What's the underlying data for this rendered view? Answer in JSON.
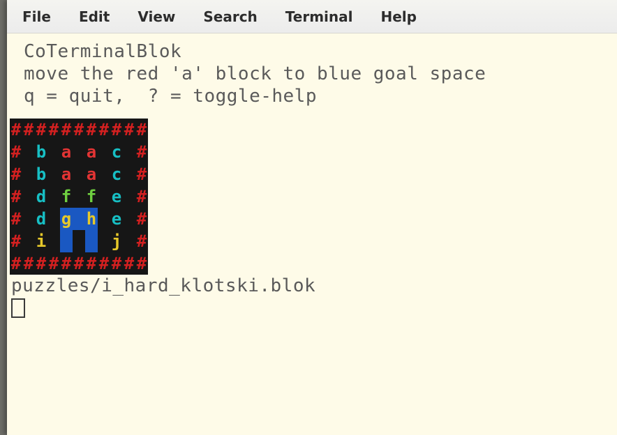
{
  "menubar": {
    "items": [
      "File",
      "Edit",
      "View",
      "Search",
      "Terminal",
      "Help"
    ]
  },
  "header": {
    "title": "CoTerminalBlok",
    "instruction": "move the red 'a' block to blue goal space",
    "controls": "q = quit,  ? = toggle-help"
  },
  "board": {
    "rows": [
      [
        {
          "ch": "#",
          "cls": "c-wall"
        },
        {
          "ch": "#",
          "cls": "c-wall"
        },
        {
          "ch": "#",
          "cls": "c-wall"
        },
        {
          "ch": "#",
          "cls": "c-wall"
        },
        {
          "ch": "#",
          "cls": "c-wall"
        },
        {
          "ch": "#",
          "cls": "c-wall"
        },
        {
          "ch": "#",
          "cls": "c-wall"
        },
        {
          "ch": "#",
          "cls": "c-wall"
        },
        {
          "ch": "#",
          "cls": "c-wall"
        },
        {
          "ch": "#",
          "cls": "c-wall"
        },
        {
          "ch": "#",
          "cls": "c-wall"
        }
      ],
      [
        {
          "ch": "#",
          "cls": "c-wall"
        },
        {
          "ch": " ",
          "cls": ""
        },
        {
          "ch": "b",
          "cls": "c-cyan"
        },
        {
          "ch": " ",
          "cls": ""
        },
        {
          "ch": "a",
          "cls": "c-red"
        },
        {
          "ch": " ",
          "cls": ""
        },
        {
          "ch": "a",
          "cls": "c-red"
        },
        {
          "ch": " ",
          "cls": ""
        },
        {
          "ch": "c",
          "cls": "c-cyan"
        },
        {
          "ch": " ",
          "cls": ""
        },
        {
          "ch": "#",
          "cls": "c-wall"
        }
      ],
      [
        {
          "ch": "#",
          "cls": "c-wall"
        },
        {
          "ch": " ",
          "cls": ""
        },
        {
          "ch": "b",
          "cls": "c-cyan"
        },
        {
          "ch": " ",
          "cls": ""
        },
        {
          "ch": "a",
          "cls": "c-red"
        },
        {
          "ch": " ",
          "cls": ""
        },
        {
          "ch": "a",
          "cls": "c-red"
        },
        {
          "ch": " ",
          "cls": ""
        },
        {
          "ch": "c",
          "cls": "c-cyan"
        },
        {
          "ch": " ",
          "cls": ""
        },
        {
          "ch": "#",
          "cls": "c-wall"
        }
      ],
      [
        {
          "ch": "#",
          "cls": "c-wall"
        },
        {
          "ch": " ",
          "cls": ""
        },
        {
          "ch": "d",
          "cls": "c-cyan"
        },
        {
          "ch": " ",
          "cls": ""
        },
        {
          "ch": "f",
          "cls": "c-green"
        },
        {
          "ch": " ",
          "cls": ""
        },
        {
          "ch": "f",
          "cls": "c-green"
        },
        {
          "ch": " ",
          "cls": ""
        },
        {
          "ch": "e",
          "cls": "c-cyan"
        },
        {
          "ch": " ",
          "cls": ""
        },
        {
          "ch": "#",
          "cls": "c-wall"
        }
      ],
      [
        {
          "ch": "#",
          "cls": "c-wall"
        },
        {
          "ch": " ",
          "cls": ""
        },
        {
          "ch": "d",
          "cls": "c-cyan"
        },
        {
          "ch": " ",
          "cls": ""
        },
        {
          "ch": "g",
          "cls": "c-yellow",
          "bg": "bg-goal"
        },
        {
          "ch": " ",
          "cls": "",
          "bg": "bg-goal"
        },
        {
          "ch": "h",
          "cls": "c-yellow",
          "bg": "bg-goal"
        },
        {
          "ch": " ",
          "cls": ""
        },
        {
          "ch": "e",
          "cls": "c-cyan"
        },
        {
          "ch": " ",
          "cls": ""
        },
        {
          "ch": "#",
          "cls": "c-wall"
        }
      ],
      [
        {
          "ch": "#",
          "cls": "c-wall"
        },
        {
          "ch": " ",
          "cls": ""
        },
        {
          "ch": "i",
          "cls": "c-yellow"
        },
        {
          "ch": " ",
          "cls": ""
        },
        {
          "ch": " ",
          "cls": "",
          "bg": "bg-goal"
        },
        {
          "ch": " ",
          "cls": ""
        },
        {
          "ch": " ",
          "cls": "",
          "bg": "bg-goal"
        },
        {
          "ch": " ",
          "cls": ""
        },
        {
          "ch": "j",
          "cls": "c-yellow"
        },
        {
          "ch": " ",
          "cls": ""
        },
        {
          "ch": "#",
          "cls": "c-wall"
        }
      ],
      [
        {
          "ch": "#",
          "cls": "c-wall"
        },
        {
          "ch": "#",
          "cls": "c-wall"
        },
        {
          "ch": "#",
          "cls": "c-wall"
        },
        {
          "ch": "#",
          "cls": "c-wall"
        },
        {
          "ch": "#",
          "cls": "c-wall"
        },
        {
          "ch": "#",
          "cls": "c-wall"
        },
        {
          "ch": "#",
          "cls": "c-wall"
        },
        {
          "ch": "#",
          "cls": "c-wall"
        },
        {
          "ch": "#",
          "cls": "c-wall"
        },
        {
          "ch": "#",
          "cls": "c-wall"
        },
        {
          "ch": "#",
          "cls": "c-wall"
        }
      ]
    ]
  },
  "footer": {
    "file_path": "puzzles/i_hard_klotski.blok"
  }
}
